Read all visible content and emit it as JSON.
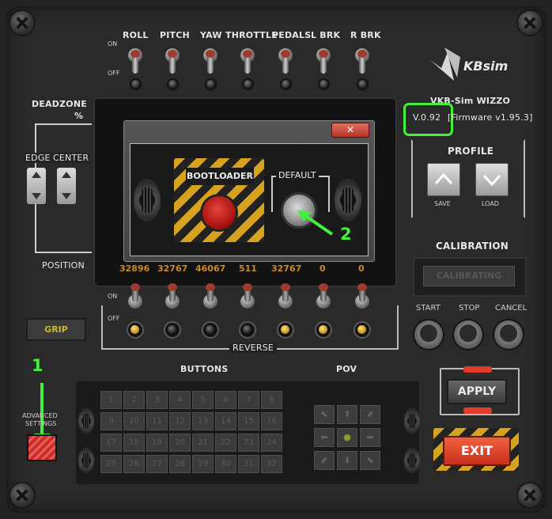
{
  "axes": {
    "labels": [
      "ROLL",
      "PITCH",
      "YAW",
      "THROTTLE",
      "PEDALS",
      "L BRK",
      "R BRK"
    ],
    "on": "ON",
    "off": "OFF",
    "values": [
      "32896",
      "32767",
      "46067",
      "511",
      "32767",
      "0",
      "0"
    ]
  },
  "deadzone": {
    "title": "DEADZONE",
    "unit": "%",
    "edge": "EDGE",
    "center": "CENTER",
    "position": "POSITION"
  },
  "brand": {
    "logo_text": "KBsim",
    "device": "VKB-Sim WIZZO",
    "version": "V.0.92",
    "firmware": "[Firmware v1.95.3]"
  },
  "profile": {
    "title": "PROFILE",
    "save": "SAVE",
    "load": "LOAD"
  },
  "calibration": {
    "title": "CALIBRATION",
    "status": "CALIBRATING",
    "start": "START",
    "stop": "STOP",
    "cancel": "CANCEL"
  },
  "dialog": {
    "close": "✕",
    "bootloader": "BOOTLOADER",
    "default": "DEFAULT"
  },
  "reverse": {
    "label": "REVERSE",
    "on": "ON",
    "off": "OFF",
    "leds": [
      true,
      false,
      false,
      false,
      true,
      true,
      true
    ]
  },
  "grip": "GRIP",
  "buttons": {
    "title": "BUTTONS",
    "numbers": [
      "1",
      "2",
      "3",
      "4",
      "5",
      "6",
      "7",
      "8",
      "9",
      "10",
      "11",
      "12",
      "13",
      "14",
      "15",
      "16",
      "17",
      "18",
      "19",
      "20",
      "21",
      "22",
      "23",
      "24",
      "25",
      "26",
      "27",
      "28",
      "29",
      "30",
      "31",
      "32"
    ]
  },
  "pov": {
    "title": "POV",
    "cells": [
      "⬉",
      "⬆",
      "⬈",
      "⬅",
      "●",
      "➡",
      "⬋",
      "⬇",
      "⬊"
    ]
  },
  "advanced": {
    "line1": "ADVANCED",
    "line2": "SETTINGS"
  },
  "apply": "APPLY",
  "exit": "EXIT",
  "annotations": {
    "step1": "1",
    "step2": "2"
  },
  "colors": {
    "annotation": "#45f03a",
    "exit": "#e0462a",
    "hazard": "#d7a21d",
    "value_text": "#c88a2b"
  }
}
